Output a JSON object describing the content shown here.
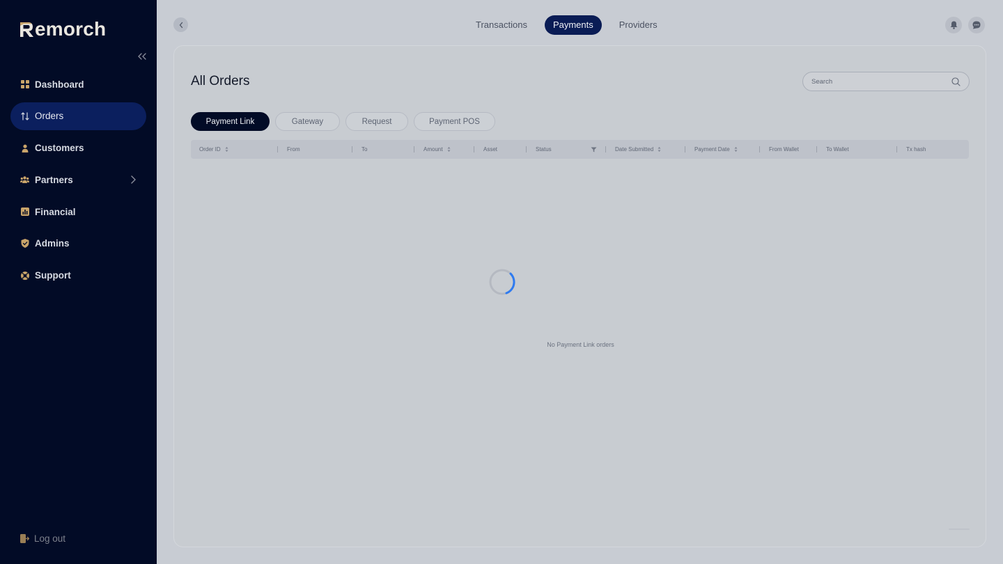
{
  "brand": {
    "name": "emorch"
  },
  "sidebar": {
    "items": [
      {
        "label": "Dashboard",
        "icon": "grid-icon",
        "active": false
      },
      {
        "label": "Orders",
        "icon": "arrows-updown-icon",
        "active": true
      },
      {
        "label": "Customers",
        "icon": "user-icon",
        "active": false
      },
      {
        "label": "Partners",
        "icon": "users-icon",
        "active": false,
        "has_chevron": true
      },
      {
        "label": "Financial",
        "icon": "chart-icon",
        "active": false
      },
      {
        "label": "Admins",
        "icon": "shield-icon",
        "active": false
      },
      {
        "label": "Support",
        "icon": "lifebuoy-icon",
        "active": false
      }
    ],
    "logout_label": "Log out"
  },
  "topbar": {
    "tabs": [
      {
        "label": "Transactions",
        "active": false
      },
      {
        "label": "Payments",
        "active": true
      },
      {
        "label": "Providers",
        "active": false
      }
    ]
  },
  "main": {
    "title": "All Orders",
    "search_placeholder": "Search",
    "sub_tabs": [
      {
        "label": "Payment Link",
        "active": true
      },
      {
        "label": "Gateway",
        "active": false
      },
      {
        "label": "Request",
        "active": false
      },
      {
        "label": "Payment POS",
        "active": false
      }
    ],
    "columns": [
      {
        "label": "Order ID",
        "sortable": true
      },
      {
        "label": "From",
        "sortable": false
      },
      {
        "label": "To",
        "sortable": false
      },
      {
        "label": "Amount",
        "sortable": true
      },
      {
        "label": "Asset",
        "sortable": false
      },
      {
        "label": "Status",
        "filterable": true
      },
      {
        "label": "Date Submitted",
        "sortable": true
      },
      {
        "label": "Payment Date",
        "sortable": true
      },
      {
        "label": "From Wallet",
        "sortable": false
      },
      {
        "label": "To Wallet",
        "sortable": false
      },
      {
        "label": "Tx hash",
        "sortable": false
      }
    ],
    "empty_message": "No Payment Link orders"
  },
  "colors": {
    "sidebar_bg": "#020b26",
    "active_nav": "#0b1f5e",
    "accent_spinner": "#2f7bf0",
    "brand_accent": "#c9a46a"
  }
}
